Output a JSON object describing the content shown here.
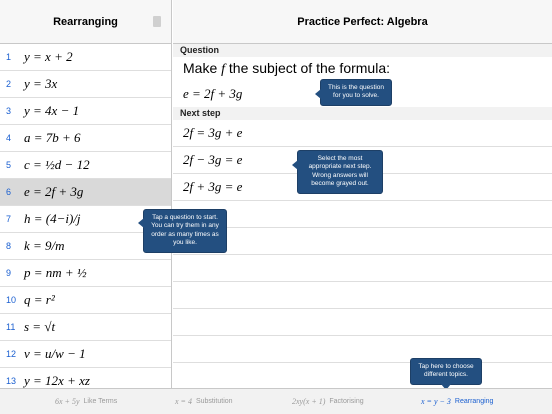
{
  "sidebar": {
    "title": "Rearranging",
    "items": [
      {
        "num": "1",
        "eq": "y = x + 2"
      },
      {
        "num": "2",
        "eq": "y = 3x"
      },
      {
        "num": "3",
        "eq": "y = 4x − 1"
      },
      {
        "num": "4",
        "eq": "a = 7b + 6"
      },
      {
        "num": "5",
        "eq": "c = ½d − 12"
      },
      {
        "num": "6",
        "eq": "e = 2f + 3g"
      },
      {
        "num": "7",
        "eq": "h = (4−i)/j"
      },
      {
        "num": "8",
        "eq": "k = 9/m"
      },
      {
        "num": "9",
        "eq": "p = nm + ½"
      },
      {
        "num": "10",
        "eq": "q = r²"
      },
      {
        "num": "11",
        "eq": "s = √t"
      },
      {
        "num": "12",
        "eq": "v = u/w − 1"
      },
      {
        "num": "13",
        "eq": "y = 12x + xz"
      }
    ],
    "selected_index": 5
  },
  "main": {
    "title": "Practice Perfect: Algebra",
    "question_header": "Question",
    "prompt_text": "Make",
    "prompt_var": "f",
    "prompt_rest": "the subject of the formula:",
    "question_eq": "e = 2f + 3g",
    "next_step_header": "Next step",
    "steps": [
      "2f = 3g + e",
      "2f − 3g = e",
      "2f + 3g = e"
    ]
  },
  "tooltips": {
    "question": "This is the question for you to solve.",
    "step": "Select the most appropriate next step. Wrong answers will become grayed out.",
    "start": "Tap a question to start. You can try them in any order as many times as you like.",
    "topics": "Tap here to choose different topics."
  },
  "tabs": [
    {
      "eq": "6x + 5y",
      "label": "Like Terms",
      "active": false
    },
    {
      "eq": "x = 4",
      "label": "Substitution",
      "active": false
    },
    {
      "eq": "2xy(x + 1)",
      "label": "Factorising",
      "active": false
    },
    {
      "eq": "x = y − 3",
      "label": "Rearranging",
      "active": true
    }
  ],
  "colors": {
    "accent": "#1a5fd0",
    "tooltip": "#234f80",
    "selected_row": "#d9d9d9"
  }
}
